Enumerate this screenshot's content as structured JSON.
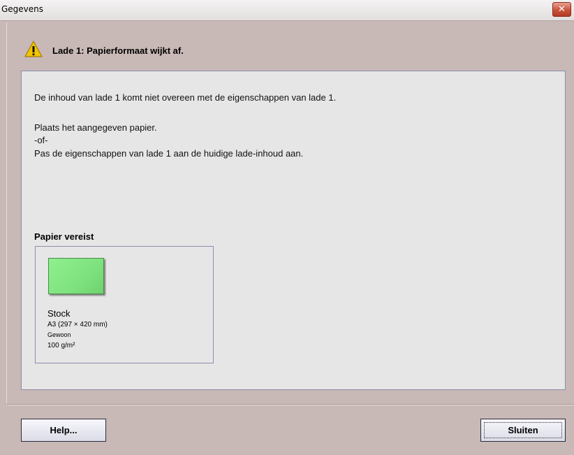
{
  "window": {
    "title": "Gegevens",
    "close_glyph": "✕"
  },
  "header": {
    "icon": "warning-icon",
    "text": "Lade 1: Papierformaat wijkt af."
  },
  "message": {
    "line1": "De inhoud van lade 1 komt niet overeen met de eigenschappen van lade 1.",
    "line2": "Plaats het aangegeven papier.",
    "line3": "-of-",
    "line4": "Pas de eigenschappen van lade 1 aan de huidige lade-inhoud aan."
  },
  "paper": {
    "section_label": "Papier vereist",
    "name": "Stock",
    "size": "A3 (297 × 420 mm)",
    "type": "Gewoon",
    "weight": "100 g/m²",
    "swatch_color": "#7ee27e"
  },
  "buttons": {
    "help": "Help...",
    "close": "Sluiten"
  }
}
